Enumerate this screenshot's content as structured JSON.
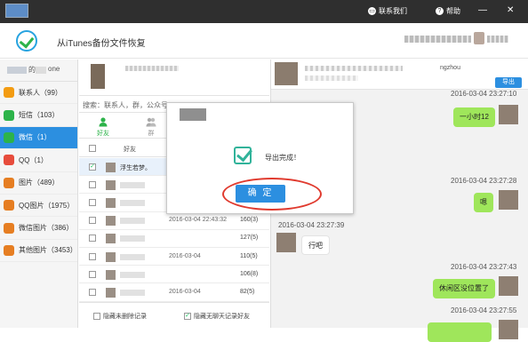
{
  "titlebar": {
    "contact_label": "联系我们",
    "help_label": "帮助",
    "minimize": "—",
    "close": "✕"
  },
  "appbar": {
    "title": "从iTunes备份文件恢复"
  },
  "device": {
    "part1": "的",
    "part2": "one"
  },
  "sidebar": {
    "items": [
      {
        "label": "联系人（99）",
        "icon": "contacts-icon",
        "color": "#f39c12"
      },
      {
        "label": "短信（103）",
        "icon": "sms-icon",
        "color": "#2db34a"
      },
      {
        "label": "微信（1）",
        "icon": "wechat-icon",
        "color": "#2db34a"
      },
      {
        "label": "QQ（1）",
        "icon": "qq-icon",
        "color": "#e74c3c"
      },
      {
        "label": "图片（489）",
        "icon": "photos-icon",
        "color": "#e67e22"
      },
      {
        "label": "QQ图片（1975）",
        "icon": "qq-photos-icon",
        "color": "#e67e22"
      },
      {
        "label": "微信图片（386）",
        "icon": "wechat-photos-icon",
        "color": "#e67e22"
      },
      {
        "label": "其他图片（3453）",
        "icon": "other-photos-icon",
        "color": "#e67e22"
      }
    ],
    "active_index": 2
  },
  "contacts_panel": {
    "search_placeholder": "搜索：联系人，群，公众号",
    "tabs": [
      {
        "label": "好友",
        "icon": "friend-icon"
      },
      {
        "label": "群",
        "icon": "group-icon"
      }
    ],
    "column_name": "好友",
    "rows": [
      {
        "name": "浮生若梦。",
        "date": "",
        "count": "",
        "checked": true
      },
      {
        "name": "",
        "date": "",
        "count": "",
        "checked": false
      },
      {
        "name": "",
        "date": "",
        "count": "",
        "checked": false
      },
      {
        "name": "",
        "date": "2016-03-04 22:43:32",
        "count": "160(3)",
        "checked": false
      },
      {
        "name": "",
        "date": "",
        "count": "127(5)",
        "checked": false
      },
      {
        "name": "",
        "date": "2016-03-04",
        "count": "110(5)",
        "checked": false
      },
      {
        "name": "",
        "date": "",
        "count": "106(8)",
        "checked": false
      },
      {
        "name": "",
        "date": "2016-03-04",
        "count": "82(5)",
        "checked": false
      },
      {
        "name": "",
        "date": "2016-03-04",
        "count": "79(4)",
        "checked": false
      }
    ],
    "footer_hide_deleted": "隐藏未删除记录",
    "footer_hide_empty": "隐藏无聊天记录好友"
  },
  "chat": {
    "header_handle": "ngzhou",
    "export_label": "导出",
    "messages": [
      {
        "time": "2016-03-04 23:27:10",
        "text": "一小时12",
        "side": "right"
      },
      {
        "time": "2016-03-04 23:27:28",
        "text": "嗯",
        "side": "right"
      },
      {
        "time": "2016-03-04 23:27:39",
        "text": "行吧",
        "side": "left"
      },
      {
        "time": "2016-03-04 23:27:43",
        "text": "休闲区没位置了",
        "side": "right"
      },
      {
        "time": "2016-03-04 23:27:55",
        "text": "",
        "side": "right"
      }
    ]
  },
  "dialog": {
    "message": "导出完成！",
    "ok_label": "确 定",
    "close": "✕"
  }
}
